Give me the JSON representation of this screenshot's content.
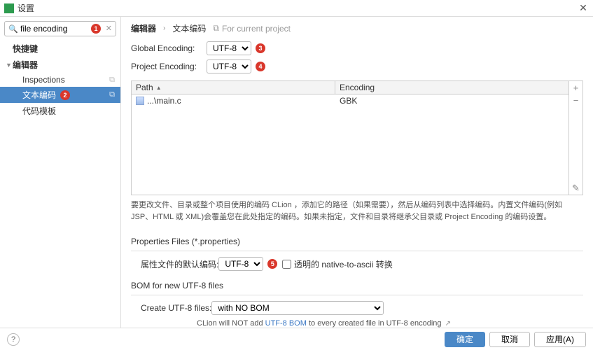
{
  "window": {
    "title": "设置"
  },
  "sidebar": {
    "search": {
      "value": "file encoding",
      "badge": "1"
    },
    "items": [
      {
        "label": "快捷键",
        "bold": true
      },
      {
        "label": "编辑器",
        "bold": true,
        "expandable": true
      },
      {
        "label": "Inspections",
        "indent": true,
        "copy": true
      },
      {
        "label": "文本编码",
        "indent": true,
        "selected": true,
        "copy": true,
        "badge": "2"
      },
      {
        "label": "代码模板",
        "indent": true
      }
    ]
  },
  "content": {
    "crumbs": {
      "a": "编辑器",
      "b": "文本编码",
      "proj": "For current project"
    },
    "global": {
      "label": "Global Encoding:",
      "value": "UTF-8",
      "badge": "3"
    },
    "project": {
      "label": "Project Encoding:",
      "value": "UTF-8",
      "badge": "4"
    },
    "table": {
      "headers": {
        "path": "Path",
        "enc": "Encoding"
      },
      "rows": [
        {
          "path": "...\\main.c",
          "enc": "GBK"
        }
      ]
    },
    "desc": "要更改文件、目录或整个项目使用的编码 CLion ，添加它的路径（如果需要），然后从编码列表中选择编码。内置文件编码(例如 JSP、HTML 或 XML)会覆盖您在此处指定的编码。如果未指定，文件和目录将继承父目录或 Project Encoding 的编码设置。",
    "prop": {
      "title": "Properties Files (*.properties)",
      "label": "属性文件的默认编码:",
      "value": "UTF-8",
      "badge": "5",
      "check_label": "透明的 native-to-ascii 转换"
    },
    "bom": {
      "title": "BOM for new UTF-8 files",
      "label": "Create UTF-8 files:",
      "value": "with NO BOM",
      "hint_a": "CLion will NOT add ",
      "hint_link": "UTF-8 BOM",
      "hint_b": " to every created file in UTF-8 encoding "
    }
  },
  "footer": {
    "ok": "确定",
    "cancel": "取消",
    "apply": "应用(A)"
  }
}
